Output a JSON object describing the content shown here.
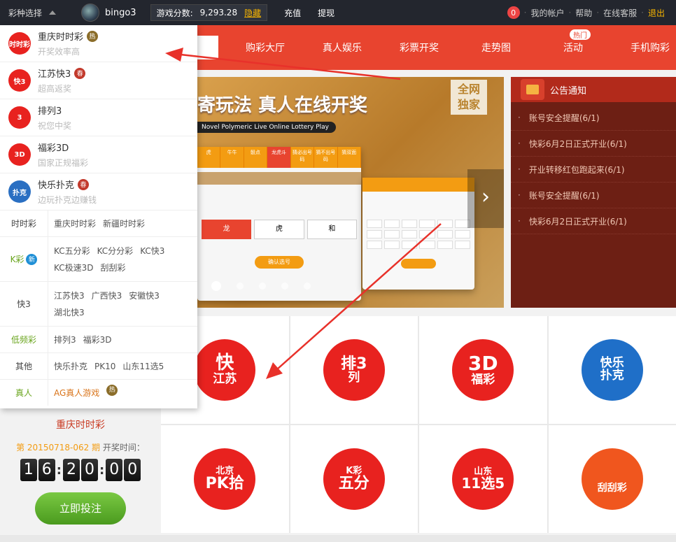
{
  "topbar": {
    "select_label": "彩种选择",
    "username": "bingo3",
    "score_label": "游戏分数:",
    "score_value": "9,293.28",
    "hide_label": "隐藏",
    "recharge": "充值",
    "withdraw": "提现",
    "msg_count": "0",
    "account": "我的帐户",
    "help": "帮助",
    "service": "在线客服",
    "logout": "退出"
  },
  "nav": {
    "items": [
      "购彩大厅",
      "真人娱乐",
      "彩票开奖",
      "走势图",
      "活动",
      "手机购彩"
    ],
    "hot_badge": "热门"
  },
  "menu": {
    "lotteries": [
      {
        "name": "重庆时时彩",
        "desc": "开奖效率高",
        "mark": "热",
        "icon": "时时彩"
      },
      {
        "name": "江苏快3",
        "desc": "超高返奖",
        "mark": "春",
        "icon": "快3"
      },
      {
        "name": "排列3",
        "desc": "祝您中奖",
        "mark": "",
        "icon": "3"
      },
      {
        "name": "福彩3D",
        "desc": "国家正规福彩",
        "mark": "",
        "icon": "3D"
      },
      {
        "name": "快乐扑克",
        "desc": "边玩扑克边赚钱",
        "mark": "春",
        "icon": "扑克"
      }
    ],
    "groups": [
      {
        "label": "时时彩",
        "items": [
          "重庆时时彩",
          "新疆时时彩"
        ]
      },
      {
        "label": "K彩",
        "badge": "新",
        "items": [
          "KC五分彩",
          "KC分分彩",
          "KC快3",
          "KC极速3D",
          "刮刮彩"
        ]
      },
      {
        "label": "快3",
        "items": [
          "江苏快3",
          "广西快3",
          "安徽快3",
          "湖北快3"
        ]
      },
      {
        "label": "低频彩",
        "items": [
          "排列3",
          "福彩3D"
        ]
      },
      {
        "label": "其他",
        "items": [
          "快乐扑克",
          "PK10",
          "山东11选5"
        ]
      },
      {
        "label": "真人",
        "items": [
          "AG真人游戏"
        ],
        "mark": "热"
      }
    ]
  },
  "banner": {
    "title": "寄玩法  真人在线开奖",
    "subtitle": "Novel Polymeric Live Online Lottery Play",
    "tag_line1": "全网",
    "tag_line2": "独家",
    "scr_cols": [
      "虎",
      "牛牛",
      "骰点",
      "龙虎斗",
      "猜必出号码",
      "猜不出号码",
      "猜双面"
    ],
    "opt1": "龙",
    "opt2": "虎",
    "opt3": "和",
    "confirm": "确认选号"
  },
  "notice": {
    "title": "公告通知",
    "items": [
      "账号安全提醒(6/1)",
      "快彩6月2日正式开业(6/1)",
      "开业转移红包跑起来(6/1)",
      "账号安全提醒(6/1)",
      "快彩6月2日正式开业(6/1)"
    ]
  },
  "games": [
    {
      "l1": "快",
      "l2": "江苏"
    },
    {
      "l1": "排3",
      "l2": "列"
    },
    {
      "l1": "3D",
      "l2": "福彩"
    },
    {
      "l1": "快乐",
      "l2": "扑克"
    },
    {
      "l1": "北京",
      "l2": "PK拾"
    },
    {
      "l1": "K彩",
      "l2": "五分"
    },
    {
      "l1": "山东",
      "l2": "11选5"
    },
    {
      "l1": "",
      "l2": "刮刮彩"
    }
  ],
  "current": {
    "name": "重庆时时彩",
    "issue": "第 20150718-062 期",
    "time_label": "开奖时间：",
    "digits": [
      "1",
      "6",
      "2",
      "0",
      "0",
      "0"
    ],
    "bet": "立即投注"
  },
  "colors": {
    "brand_red": "#e8442f",
    "topbar": "#23262e",
    "accent_orange": "#f39c12",
    "green": "#6aa51e"
  }
}
